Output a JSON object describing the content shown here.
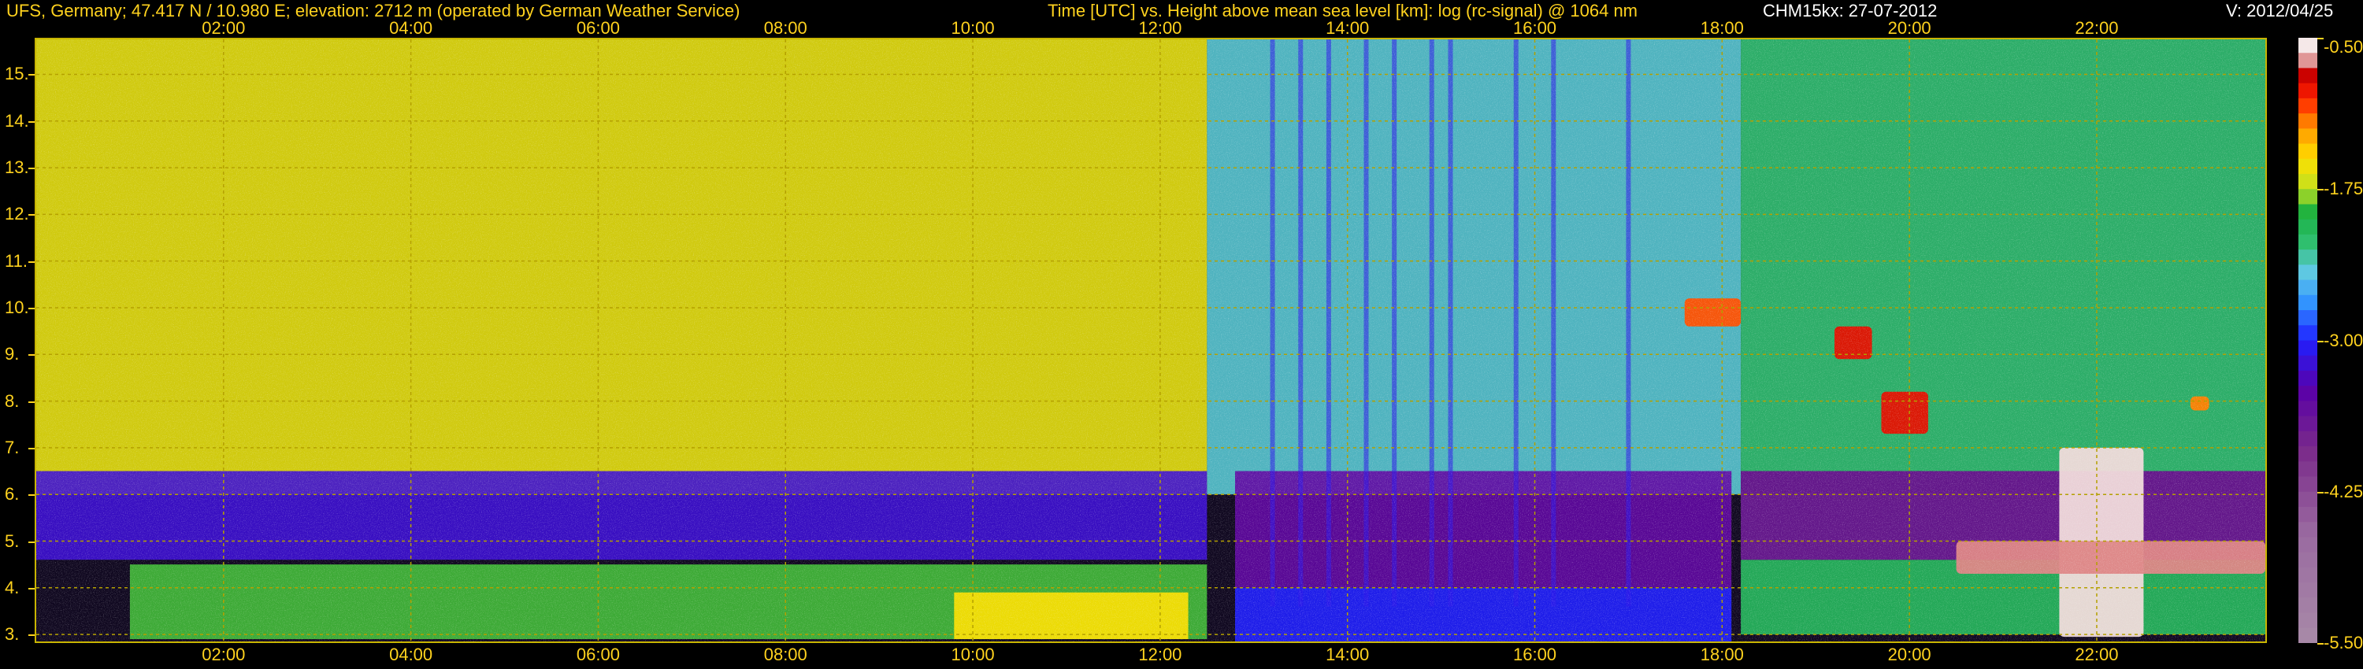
{
  "header": {
    "station": "UFS, Germany; 47.417 N / 10.980 E; elevation: 2712 m  (operated by German Weather Service)",
    "title": "Time [UTC] vs. Height above mean sea level [km]: log (rc-signal) @ 1064 nm",
    "instrument": "CHM15kx: 27-07-2012",
    "version": "V: 2012/04/25"
  },
  "colors": {
    "text": "#ffd21e",
    "frame": "#c8b400",
    "grid": "#b4a000",
    "background": "#000000"
  },
  "chart_data": {
    "type": "heatmap",
    "title": "Time [UTC] vs. Height above mean sea level [km]: log (rc-signal) @ 1064 nm",
    "xlabel": "Time [UTC]",
    "ylabel": "Height above mean sea level [km]",
    "x_unit": "hours UTC",
    "xlim": [
      0.0,
      23.8
    ],
    "ylim": [
      2.85,
      15.75
    ],
    "x_tick_values": [
      2,
      4,
      6,
      8,
      10,
      12,
      14,
      16,
      18,
      20,
      22
    ],
    "x_tick_labels": [
      "02:00",
      "04:00",
      "06:00",
      "08:00",
      "10:00",
      "12:00",
      "14:00",
      "16:00",
      "18:00",
      "20:00",
      "22:00"
    ],
    "y_ticks": [
      3,
      4,
      5,
      6,
      7,
      8,
      9,
      10,
      11,
      12,
      13,
      14,
      15
    ],
    "y_tick_labels": [
      "3.",
      "4.",
      "5.",
      "6.",
      "7.",
      "8.",
      "9.",
      "10.",
      "11.",
      "12.",
      "13.",
      "14.",
      "15."
    ],
    "grid": true,
    "colorbar": {
      "range": [
        -5.5,
        -0.5
      ],
      "ticks": [
        -0.5,
        -1.75,
        -3.0,
        -4.25,
        -5.5
      ],
      "tick_labels": [
        "-0.50",
        "-1.75",
        "-3.00",
        "-4.25",
        "-5.50"
      ],
      "stops": [
        {
          "value": -5.5,
          "color": "#a88aa8"
        },
        {
          "value": -4.6,
          "color": "#9a6aa0"
        },
        {
          "value": -3.9,
          "color": "#7a2a8a"
        },
        {
          "value": -3.4,
          "color": "#5a00a8"
        },
        {
          "value": -3.0,
          "color": "#2020ff"
        },
        {
          "value": -2.7,
          "color": "#3090ff"
        },
        {
          "value": -2.45,
          "color": "#60c8e8"
        },
        {
          "value": -2.2,
          "color": "#30c070"
        },
        {
          "value": -1.95,
          "color": "#18b040"
        },
        {
          "value": -1.75,
          "color": "#c0e020"
        },
        {
          "value": -1.5,
          "color": "#ffe000"
        },
        {
          "value": -1.25,
          "color": "#ff9800"
        },
        {
          "value": -1.0,
          "color": "#ff2000"
        },
        {
          "value": -0.8,
          "color": "#c80000"
        },
        {
          "value": -0.65,
          "color": "#e8c8c8"
        },
        {
          "value": -0.5,
          "color": "#ffffff"
        }
      ]
    },
    "regions": [
      {
        "name": "noisy upper troposphere, morning",
        "x": [
          0.0,
          12.5
        ],
        "y": [
          6.0,
          15.75
        ],
        "value": -1.6
      },
      {
        "name": "noisy upper troposphere, afternoon",
        "x": [
          12.5,
          18.2
        ],
        "y": [
          6.0,
          15.75
        ],
        "value": -2.4
      },
      {
        "name": "upper troposphere, evening",
        "x": [
          18.2,
          23.8
        ],
        "y": [
          6.5,
          15.75
        ],
        "value": -2.2
      },
      {
        "name": "mid-level transition",
        "x": [
          0.0,
          12.5
        ],
        "y": [
          4.6,
          6.5
        ],
        "value": -3.2
      },
      {
        "name": "morning boundary layer",
        "x": [
          1.0,
          12.5
        ],
        "y": [
          2.9,
          4.5
        ],
        "value": -1.9
      },
      {
        "name": "late-morning aerosol layer",
        "x": [
          9.8,
          12.3
        ],
        "y": [
          2.9,
          3.9
        ],
        "value": -1.5
      },
      {
        "name": "afternoon low-level layer",
        "x": [
          12.8,
          18.1
        ],
        "y": [
          2.85,
          4.0
        ],
        "value": -3.0
      },
      {
        "name": "afternoon lower troposphere",
        "x": [
          12.8,
          18.1
        ],
        "y": [
          4.0,
          6.5
        ],
        "value": -3.5
      },
      {
        "name": "evening boundary layer",
        "x": [
          18.2,
          23.8
        ],
        "y": [
          3.0,
          4.6
        ],
        "value": -2.1
      },
      {
        "name": "evening mid-level",
        "x": [
          18.2,
          23.8
        ],
        "y": [
          4.6,
          6.5
        ],
        "value": -3.7
      }
    ],
    "cloud_features": [
      {
        "name": "cirrus near 18 UTC",
        "x": [
          17.6,
          18.2
        ],
        "y": [
          9.6,
          10.2
        ],
        "value": -1.1
      },
      {
        "name": "descending cloud",
        "x": [
          19.2,
          19.6
        ],
        "y": [
          8.9,
          9.6
        ],
        "value": -0.9
      },
      {
        "name": "descending cloud",
        "x": [
          19.7,
          20.2
        ],
        "y": [
          7.3,
          8.2
        ],
        "value": -0.9
      },
      {
        "name": "convective cloud",
        "x": [
          21.6,
          22.5
        ],
        "y": [
          2.95,
          7.0
        ],
        "value": -0.6
      },
      {
        "name": "small cloud",
        "x": [
          23.0,
          23.2
        ],
        "y": [
          7.8,
          8.1
        ],
        "value": -1.2
      },
      {
        "name": "low cloud tops",
        "x": [
          20.5,
          23.8
        ],
        "y": [
          4.3,
          5.0
        ],
        "value": -0.7
      }
    ],
    "vertical_streaks_x": [
      13.2,
      13.5,
      13.8,
      14.2,
      14.5,
      14.9,
      15.1,
      15.8,
      16.2,
      17.0
    ]
  }
}
